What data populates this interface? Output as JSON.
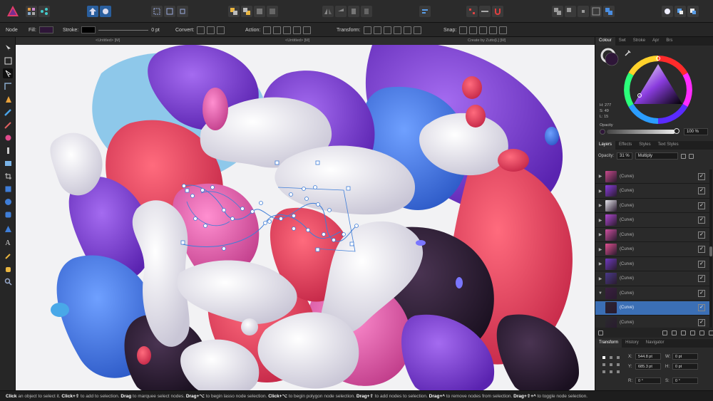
{
  "context_toolbar": {
    "mode_label": "Node",
    "fill_label": "Fill:",
    "fill_color": "#2e1638",
    "stroke_label": "Stroke:",
    "stroke_color": "#000000",
    "stroke_width": "0 pt",
    "convert_label": "Convert:",
    "action_label": "Action:",
    "transform_label": "Transform:",
    "snap_label": "Snap:"
  },
  "document_tabs": {
    "left": "<Untitled> [M]",
    "middle": "<Untitled> [M]",
    "right": "Create by Zutto[L] [M]"
  },
  "colour_panel": {
    "tabs": [
      "Colour",
      "Swt",
      "Stroke",
      "Apr",
      "Brs"
    ],
    "active_tab": "Colour",
    "h_readout": "H: 277",
    "s_readout": "S: 49",
    "l_readout": "L: 15",
    "opacity_label": "Opacity",
    "opacity_value": "100 %",
    "opacity_fraction": 1.0,
    "current_color": "#2e1638"
  },
  "layers_panel": {
    "tabs": [
      "Layers",
      "Effects",
      "Styles",
      "Text Styles"
    ],
    "active_tab": "Layers",
    "opacity_label": "Opacity:",
    "opacity_value": "31 %",
    "blend_mode": "Multiply",
    "layers": [
      {
        "name": "(Curve)",
        "expanded": false,
        "visible": true,
        "selected": false
      },
      {
        "name": "(Curve)",
        "expanded": false,
        "visible": true,
        "selected": false
      },
      {
        "name": "(Curve)",
        "expanded": false,
        "visible": true,
        "selected": false
      },
      {
        "name": "(Curve)",
        "expanded": false,
        "visible": true,
        "selected": false
      },
      {
        "name": "(Curve)",
        "expanded": false,
        "visible": true,
        "selected": false
      },
      {
        "name": "(Curve)",
        "expanded": false,
        "visible": true,
        "selected": false
      },
      {
        "name": "(Curve)",
        "expanded": false,
        "visible": true,
        "selected": false
      },
      {
        "name": "(Curve)",
        "expanded": false,
        "visible": true,
        "selected": false
      },
      {
        "name": "(Curve)",
        "expanded": true,
        "visible": true,
        "selected": false
      },
      {
        "name": "(Curve)",
        "expanded": false,
        "visible": true,
        "selected": true
      },
      {
        "name": "(Curve)",
        "expanded": false,
        "visible": true,
        "selected": false
      }
    ]
  },
  "transform_panel": {
    "tabs": [
      "Transform",
      "History",
      "Navigator"
    ],
    "active_tab": "Transform",
    "x_label": "X:",
    "x_value": "544.8 pt",
    "y_label": "Y:",
    "y_value": "685.3 pt",
    "w_label": "W:",
    "w_value": "0 pt",
    "h_label": "H:",
    "h_value": "0 pt",
    "r_label": "R:",
    "r_value": "0 °",
    "s_label": "S:",
    "s_value": "0 °"
  },
  "status_bar": {
    "parts": [
      {
        "b": "Click",
        "t": " an object to select it. "
      },
      {
        "b": "Click+⇧",
        "t": " to add to selection. "
      },
      {
        "b": "Drag",
        "t": " to marquee select nodes. "
      },
      {
        "b": "Drag+⌥",
        "t": " to begin lasso node selection. "
      },
      {
        "b": "Click+⌥",
        "t": " to begin polygon node selection. "
      },
      {
        "b": "Drag+⇧",
        "t": " to add nodes to selection. "
      },
      {
        "b": "Drag+^",
        "t": " to remove nodes from selection. "
      },
      {
        "b": "Drag+⇧+^",
        "t": " to toggle node selection."
      }
    ]
  },
  "icons": {
    "tools": [
      "move-icon",
      "artboard-icon",
      "node-icon",
      "corner-icon",
      "pen-icon",
      "pencil-icon",
      "brush-icon",
      "fill-icon",
      "transparency-icon",
      "place-image-icon",
      "crop-icon",
      "rectangle-icon",
      "ellipse-icon",
      "rounded-rect-icon",
      "triangle-icon",
      "text-icon",
      "eyedropper-icon",
      "hand-icon",
      "zoom-icon"
    ]
  },
  "artwork_colors": {
    "white": "#ecebf1",
    "purple": "#7c3ed9",
    "blue": "#4a7ee6",
    "red": "#ea3d5c",
    "pink": "#e9579f",
    "dark": "#2a1b2f",
    "violet": "#a16ae8"
  }
}
